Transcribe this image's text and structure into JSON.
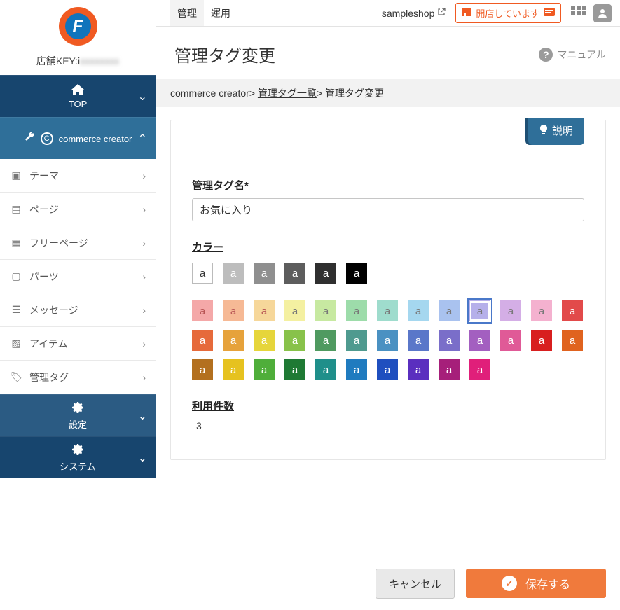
{
  "sidebar": {
    "shop_key_label": "店舗KEY:i",
    "shop_key_blur": "xxxxxxxx",
    "top": "TOP",
    "commerce_creator": "commerce creator",
    "items": [
      {
        "label": "テーマ"
      },
      {
        "label": "ページ"
      },
      {
        "label": "フリーページ"
      },
      {
        "label": "パーツ"
      },
      {
        "label": "メッセージ"
      },
      {
        "label": "アイテム"
      },
      {
        "label": "管理タグ"
      }
    ],
    "settings": "設定",
    "system": "システム"
  },
  "topbar": {
    "tab_admin": "管理",
    "tab_ops": "運用",
    "shop_link": "sampleshop",
    "open_label": "開店しています"
  },
  "page": {
    "title": "管理タグ変更",
    "manual": "マニュアル"
  },
  "breadcrumb": {
    "root": "commerce creator",
    "list": "管理タグ一覧",
    "current": "管理タグ変更"
  },
  "form": {
    "explain": "説明",
    "name_label": "管理タグ名",
    "name_required": "*",
    "name_value": "お気に入り",
    "color_label": "カラー",
    "swatch_letter": "a",
    "usage_label": "利用件数",
    "usage_value": "3"
  },
  "colors": {
    "row1": [
      {
        "bg": "#ffffff",
        "cls": "bordered"
      },
      {
        "bg": "#bdbdbd",
        "cls": "wtext"
      },
      {
        "bg": "#8f8f8f",
        "cls": "wtext"
      },
      {
        "bg": "#5d5d5d",
        "cls": "wtext"
      },
      {
        "bg": "#2f2f2f",
        "cls": "wtext"
      },
      {
        "bg": "#000000",
        "cls": "wtext"
      }
    ],
    "row2": [
      {
        "bg": "#f4a8a8",
        "cls": "ltext"
      },
      {
        "bg": "#f6b995",
        "cls": "ltext"
      },
      {
        "bg": "#f6d79a",
        "cls": "ltext"
      },
      {
        "bg": "#f4f0a1",
        "cls": "light"
      },
      {
        "bg": "#c7e9a1",
        "cls": "light"
      },
      {
        "bg": "#9ddcaa",
        "cls": "light"
      },
      {
        "bg": "#9fdccd",
        "cls": "light"
      },
      {
        "bg": "#a5d7ef",
        "cls": "light"
      },
      {
        "bg": "#a9c2ef",
        "cls": "light"
      },
      {
        "bg": "#b6b0ea",
        "cls": "light",
        "selected": true
      },
      {
        "bg": "#d4aee6",
        "cls": "light"
      },
      {
        "bg": "#f4b1cf",
        "cls": "light"
      }
    ],
    "row3": [
      {
        "bg": "#e24a4a",
        "cls": "wtext"
      },
      {
        "bg": "#e66a3b",
        "cls": "wtext"
      },
      {
        "bg": "#e6a23b",
        "cls": "wtext"
      },
      {
        "bg": "#e6d53b",
        "cls": "wtext"
      },
      {
        "bg": "#88c24a",
        "cls": "wtext"
      },
      {
        "bg": "#4f9a60",
        "cls": "wtext"
      },
      {
        "bg": "#4f9a8f",
        "cls": "wtext"
      },
      {
        "bg": "#4a91c2",
        "cls": "wtext"
      },
      {
        "bg": "#5a77c9",
        "cls": "wtext"
      },
      {
        "bg": "#7a6ec9",
        "cls": "wtext"
      },
      {
        "bg": "#a35fc0",
        "cls": "wtext"
      },
      {
        "bg": "#e05a97",
        "cls": "wtext"
      }
    ],
    "row4": [
      {
        "bg": "#d81f1f",
        "cls": "wtext"
      },
      {
        "bg": "#e0631f",
        "cls": "wtext"
      },
      {
        "bg": "#b3701f",
        "cls": "wtext"
      },
      {
        "bg": "#e6c21f",
        "cls": "wtext"
      },
      {
        "bg": "#4fae3a",
        "cls": "wtext"
      },
      {
        "bg": "#1f7a34",
        "cls": "wtext"
      },
      {
        "bg": "#1f8f8a",
        "cls": "wtext"
      },
      {
        "bg": "#1f7bbf",
        "cls": "wtext"
      },
      {
        "bg": "#1f4fbf",
        "cls": "wtext"
      },
      {
        "bg": "#5a2fbf",
        "cls": "wtext"
      },
      {
        "bg": "#a61f7a",
        "cls": "wtext"
      },
      {
        "bg": "#e01f7a",
        "cls": "wtext"
      }
    ]
  },
  "footer": {
    "cancel": "キャンセル",
    "save": "保存する"
  }
}
